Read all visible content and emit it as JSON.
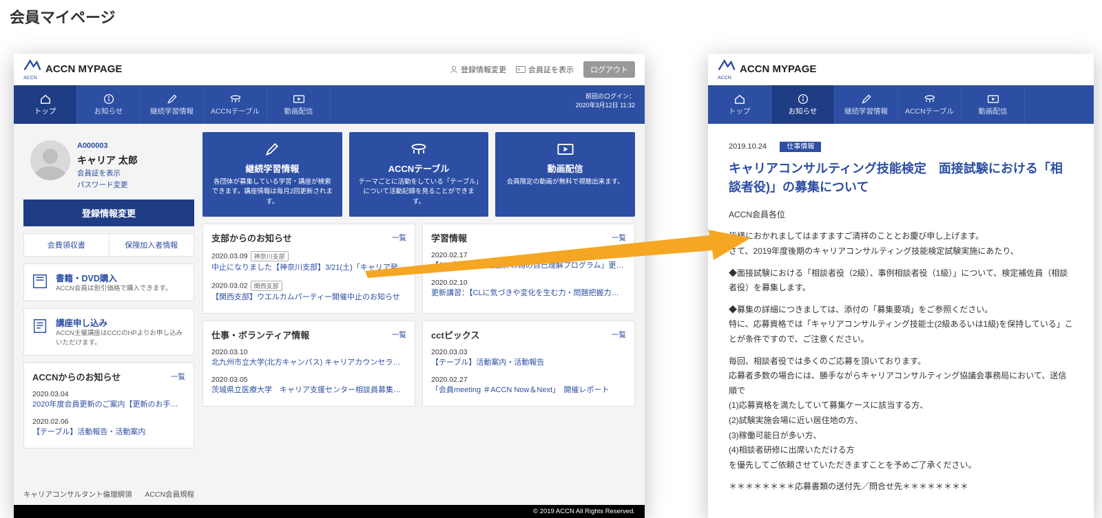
{
  "page_heading": "会員マイページ",
  "brand": "ACCN MYPAGE",
  "brand_small": "ACCN",
  "header_utils": {
    "reg_change": "登録情報変更",
    "show_card": "会員証を表示",
    "logout": "ログアウト"
  },
  "nav": {
    "items": [
      {
        "label": "トップ"
      },
      {
        "label": "お知らせ"
      },
      {
        "label": "継続学習情報"
      },
      {
        "label": "ACCNテーブル"
      },
      {
        "label": "動画配信"
      }
    ],
    "last_login_label": "前回のログイン：",
    "last_login_value": "2020年3月12日 11:32"
  },
  "profile": {
    "member_id": "A000003",
    "member_name": "キャリア 太郎",
    "link_card": "会員証を表示",
    "link_pw": "パスワード変更"
  },
  "big_button": "登録情報変更",
  "twin": {
    "a": "会費領収書",
    "b": "保険加入者情報"
  },
  "side_links": [
    {
      "title": "書籍・DVD購入",
      "desc": "ACCN会員は割引価格で購入できます。"
    },
    {
      "title": "講座申し込み",
      "desc": "ACCN主催講座はCCCのHPよりお申し込みいただけます。"
    }
  ],
  "accn_news": {
    "title": "ACCNからのお知らせ",
    "more": "一覧",
    "items": [
      {
        "date": "2020.03.04",
        "text": "2020年度会員更新のご案内【更新のお手続き…"
      },
      {
        "date": "2020.02.06",
        "text": "【テーブル】活動報告・活動案内"
      }
    ]
  },
  "tiles": [
    {
      "title": "継続学習情報",
      "desc": "各団体が募集している学習・講座が検索できます。講座情報は毎月2回更新されます。"
    },
    {
      "title": "ACCNテーブル",
      "desc": "テーマごとに活動をしている「テーブル」について活動記録を見ることができます。"
    },
    {
      "title": "動画配信",
      "desc": "会員限定の動画が無料で視聴出来ます。"
    }
  ],
  "panels": {
    "branch": {
      "title": "支部からのお知らせ",
      "more": "一覧",
      "items": [
        {
          "date": "2020.03.09",
          "tag": "神奈川支部",
          "text": "中止になりました【神奈川支部】3/21(土)「キャリア発達…"
        },
        {
          "date": "2020.03.02",
          "tag": "関西支部",
          "text": "【関西支部】ウエルカムパーティー開催中止のお知らせ"
        }
      ]
    },
    "study": {
      "title": "学習情報",
      "more": "一覧",
      "items": [
        {
          "date": "2020.02.17",
          "text": "【JCC】「職業生活設計の為の自己理解プログラム」更新…"
        },
        {
          "date": "2020.02.10",
          "text": "更新講習：【CLに気づきや変化を生む力・問題把握力と…"
        }
      ]
    },
    "job": {
      "title": "仕事・ボランティア情報",
      "more": "一覧",
      "items": [
        {
          "date": "2020.03.10",
          "text": "北九州市立大学(北方キャンパス) キャリアカウンセラ…"
        },
        {
          "date": "2020.03.05",
          "text": "茨城県立医療大学　キャリア支援センター相談員募集の…"
        }
      ]
    },
    "topics": {
      "title": "cctピックス",
      "more": "一覧",
      "items": [
        {
          "date": "2020.03.03",
          "text": "【テーブル】活動案内・活動報告"
        },
        {
          "date": "2020.02.27",
          "text": "「会員meeting ＃ACCN Now＆Next」　開催レポート"
        }
      ]
    }
  },
  "footer": {
    "link_a": "キャリアコンサルタント倫理綱領",
    "link_b": "ACCN会員規程",
    "copyright": "© 2019 ACCN All Rights Reserved."
  },
  "article": {
    "date": "2019.10.24",
    "category": "仕事情報",
    "title": "キャリアコンサルティング技能検定　面接試験における「相談者役)」の募集について",
    "salutation": "ACCN会員各位",
    "p1a": "皆様におかれましてはますますご清祥のこととお慶び申し上げます。",
    "p1b": "さて、2019年度後期のキャリアコンサルティング技能検定試験実施にあたり、",
    "p2": "◆面接試験における「相談者役（2級）、事例相談者役（1級）」について、検定補佐員（相談者役）を募集します。",
    "p3a": "◆募集の詳細につきましては、添付の「募集要項」をご参照ください。",
    "p3b": "特に、応募資格では「キャリアコンサルティング技能士(2級あるいは1級)を保持している」ことが条件ですので、ご注意ください。",
    "p4a": "毎回、相談者役では多くのご応募を頂いております。",
    "p4b": "応募者多数の場合には、勝手ながらキャリアコンサルティング協議会事務局において、送信順で",
    "l1": "(1)応募資格を満たしていて募集ケースに該当する方、",
    "l2": "(2)試験実施会場に近い居住地の方、",
    "l3": "(3)稼働可能日が多い方、",
    "l4": "(4)相談者研修に出席いただける方",
    "p5": "を優先してご依頼させていただきますことを予めご了承ください。",
    "sep": "＊＊＊＊＊＊＊＊応募書類の送付先／問合せ先＊＊＊＊＊＊＊＊"
  }
}
